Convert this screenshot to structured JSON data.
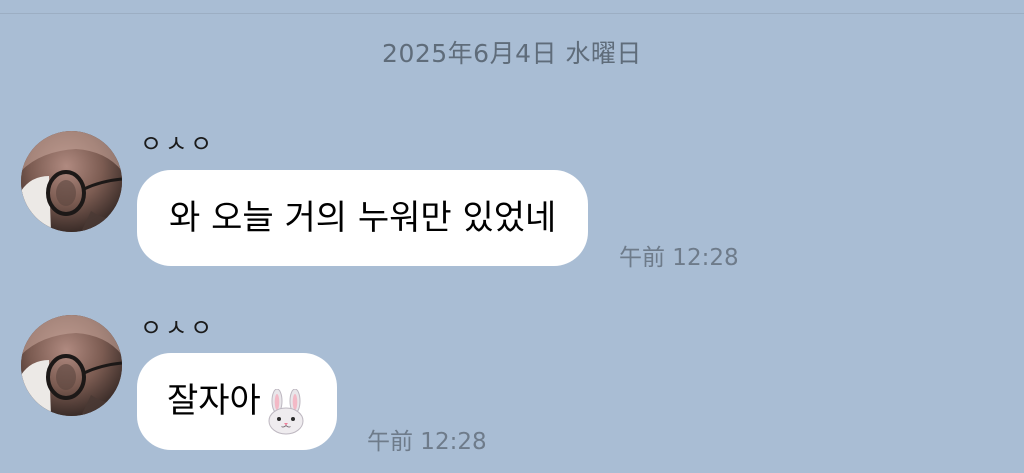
{
  "chat": {
    "date_header": "2025年6月4日 水曜日",
    "messages": [
      {
        "sender": "ㅇㅅㅇ",
        "text": "와 오늘 거의 누워만 있었네",
        "emoji": "",
        "time": "午前 12:28"
      },
      {
        "sender": "ㅇㅅㅇ",
        "text": "잘자아",
        "emoji": "rabbit-face-icon",
        "time": "午前 12:28"
      }
    ]
  },
  "colors": {
    "background": "#a9bdd4",
    "bubble": "#ffffff",
    "timestamp": "#6e7b8a"
  }
}
